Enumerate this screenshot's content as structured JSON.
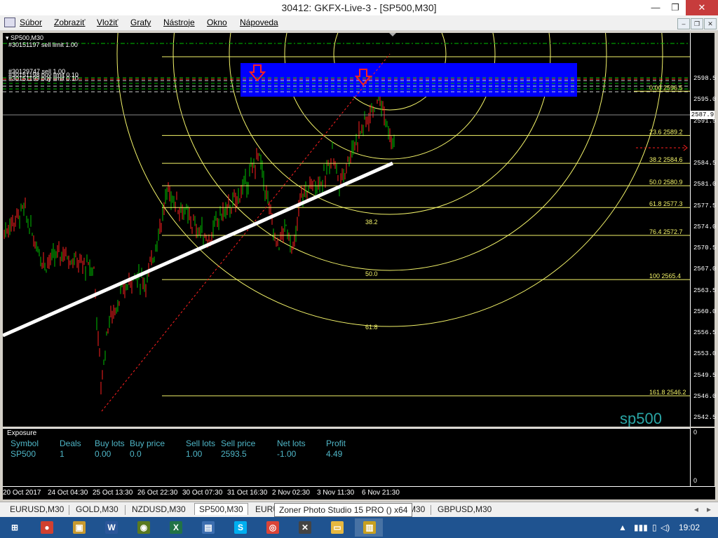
{
  "window": {
    "title": "30412: GKFX-Live-3 - [SP500,M30]",
    "minimize_glyph": "—",
    "restore_glyph": "❐",
    "close_glyph": "✕"
  },
  "menu": [
    "Súbor",
    "Zobraziť",
    "Vložiť",
    "Grafy",
    "Nástroje",
    "Okno",
    "Nápoveda"
  ],
  "mdi_buttons": [
    "–",
    "❐",
    "✕"
  ],
  "chart": {
    "header": "SP500,M30",
    "order_label": "#30151197 sell limit 1.00",
    "overlay_labels": [
      "#30129747 sell 1.00",
      "#30151198 buy limit 0.10",
      "#30151199 buy limit 0.10"
    ],
    "watermark": "sp500",
    "current_price": "2587.9",
    "price_labels": [
      "2598.5",
      "2595.0",
      "2591.5",
      "2584.5",
      "2581.0",
      "2577.5",
      "2574.0",
      "2570.5",
      "2567.0",
      "2563.5",
      "2560.0",
      "2556.5",
      "2553.0",
      "2549.5",
      "2546.0",
      "2542.5"
    ],
    "fib_levels": [
      {
        "ratio": "0.00",
        "price": "2596.5"
      },
      {
        "ratio": "23.6",
        "price": "2589.2"
      },
      {
        "ratio": "38.2",
        "price": "2584.6"
      },
      {
        "ratio": "50.0",
        "price": "2580.9"
      },
      {
        "ratio": "61.8",
        "price": "2577.3"
      },
      {
        "ratio": "76.4",
        "price": "2572.7"
      },
      {
        "ratio": "100",
        "price": "2565.4"
      },
      {
        "ratio": "161.8",
        "price": "2546.2"
      }
    ],
    "fib_arc_labels": [
      "38.2",
      "50.0",
      "61.8"
    ],
    "time_labels": [
      "20 Oct 2017",
      "24 Oct 04:30",
      "25 Oct 13:30",
      "26 Oct 22:30",
      "30 Oct 07:30",
      "31 Oct 16:30",
      "2 Nov 02:30",
      "3 Nov 11:30",
      "6 Nov 21:30"
    ],
    "colors": {
      "background": "#000000",
      "bull": "#00c000",
      "bear": "#ff2020",
      "fib": "#f5f56a",
      "zone": "#0000ff",
      "trendline": "#ffffff",
      "watermark": "#2aa6a6"
    }
  },
  "exposure": {
    "title": "Exposure",
    "headers": [
      "Symbol",
      "Deals",
      "Buy lots",
      "Buy price",
      "Sell lots",
      "Sell price",
      "Net lots",
      "Profit"
    ],
    "row": [
      "SP500",
      "1",
      "0.00",
      "0.0",
      "1.00",
      "2593.5",
      "-1.00",
      "4.49"
    ],
    "axis_top": "0",
    "axis_bottom": "0"
  },
  "tabs": [
    "EURUSD,M30",
    "GOLD,M30",
    "NZDUSD,M30",
    "SP500,M30",
    "EURU",
    "M30",
    "GBPUSD,M30"
  ],
  "tab_arrows": [
    "◂",
    "▸"
  ],
  "tooltip": "Zoner Photo Studio 15 PRO  () x64",
  "taskbar": {
    "icons": [
      {
        "name": "start-icon",
        "glyph": "⊞",
        "color": "#1f5390"
      },
      {
        "name": "paint-icon",
        "glyph": "●",
        "color": "#d04030"
      },
      {
        "name": "folder-app-icon",
        "glyph": "▣",
        "color": "#c89a30"
      },
      {
        "name": "word-icon",
        "glyph": "W",
        "color": "#2b579a"
      },
      {
        "name": "globe-app-icon",
        "glyph": "◉",
        "color": "#5a7a20"
      },
      {
        "name": "excel-icon",
        "glyph": "X",
        "color": "#217346"
      },
      {
        "name": "photos-icon",
        "glyph": "▤",
        "color": "#3d6fb0"
      },
      {
        "name": "skype-icon",
        "glyph": "S",
        "color": "#00aff0"
      },
      {
        "name": "chrome-icon",
        "glyph": "◎",
        "color": "#db4437"
      },
      {
        "name": "xtrade-icon",
        "glyph": "✕",
        "color": "#444444"
      },
      {
        "name": "explorer-icon",
        "glyph": "▭",
        "color": "#e6b840"
      },
      {
        "name": "mt4-icon",
        "glyph": "▥",
        "color": "#c8a020"
      }
    ],
    "clock": "19:02",
    "tray": [
      "▲",
      "▮▮▮",
      "▯",
      "◁)"
    ]
  }
}
